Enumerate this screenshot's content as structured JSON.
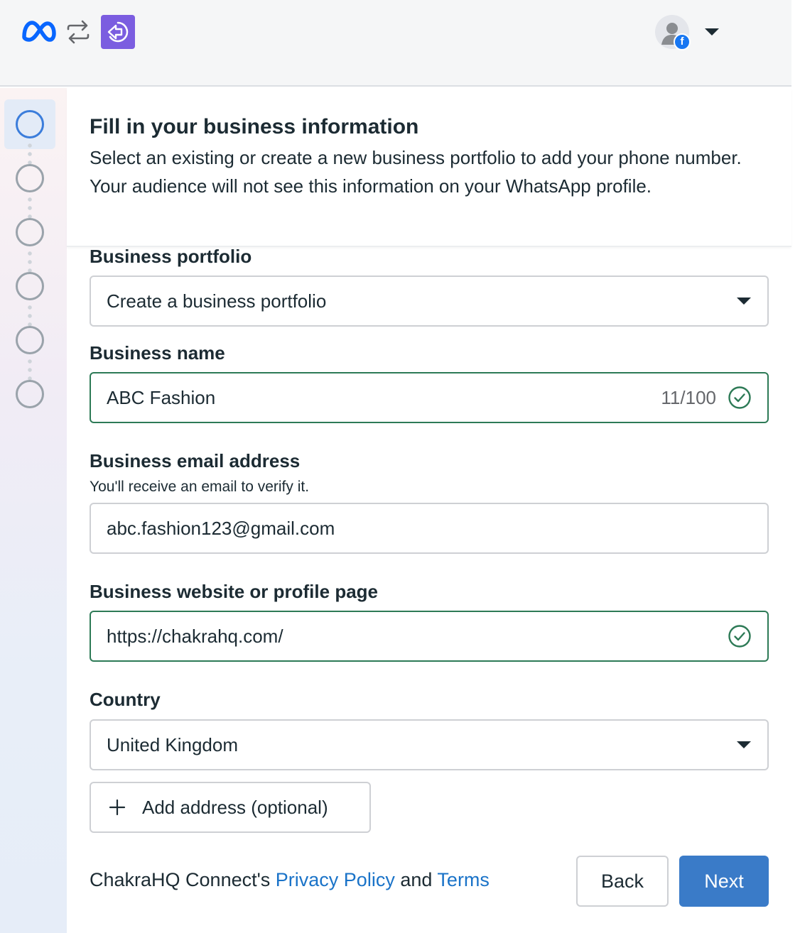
{
  "header": {
    "logo_icon": "meta-logo-icon",
    "switch_icon": "switch-arrows-icon",
    "app_icon": "app-diamond-arrow-icon",
    "account_badge": "f",
    "colors": {
      "meta_blue": "#0866ff",
      "app_purple": "#7b5de0",
      "facebook_blue": "#1877f2"
    }
  },
  "stepper": {
    "total_steps": 6,
    "active_step": 1,
    "active_color": "#3b7ddb"
  },
  "form": {
    "title": "Fill in your business information",
    "subtitle": "Select an existing or create a new business portfolio to add your phone number. Your audience will not see this information on your WhatsApp profile.",
    "portfolio": {
      "label": "Business portfolio",
      "selected": "Create a business portfolio"
    },
    "business_name": {
      "label": "Business name",
      "value": "ABC Fashion",
      "counter": "11/100",
      "valid": true
    },
    "email": {
      "label": "Business email address",
      "help": "You'll receive an email to verify it.",
      "value": "abc.fashion123@gmail.com"
    },
    "website": {
      "label": "Business website or profile page",
      "value": "https://chakrahq.com/",
      "valid": true
    },
    "country": {
      "label": "Country",
      "selected": "United Kingdom"
    },
    "add_address_label": "Add address (optional)"
  },
  "footer": {
    "prefix": "ChakraHQ Connect's",
    "privacy_link": "Privacy Policy",
    "conjunction": "and",
    "terms_link": "Terms",
    "link_color": "#1a73c8"
  },
  "buttons": {
    "back": "Back",
    "next": "Next",
    "primary_color": "#3a7bc8",
    "valid_color": "#2d7a56"
  }
}
